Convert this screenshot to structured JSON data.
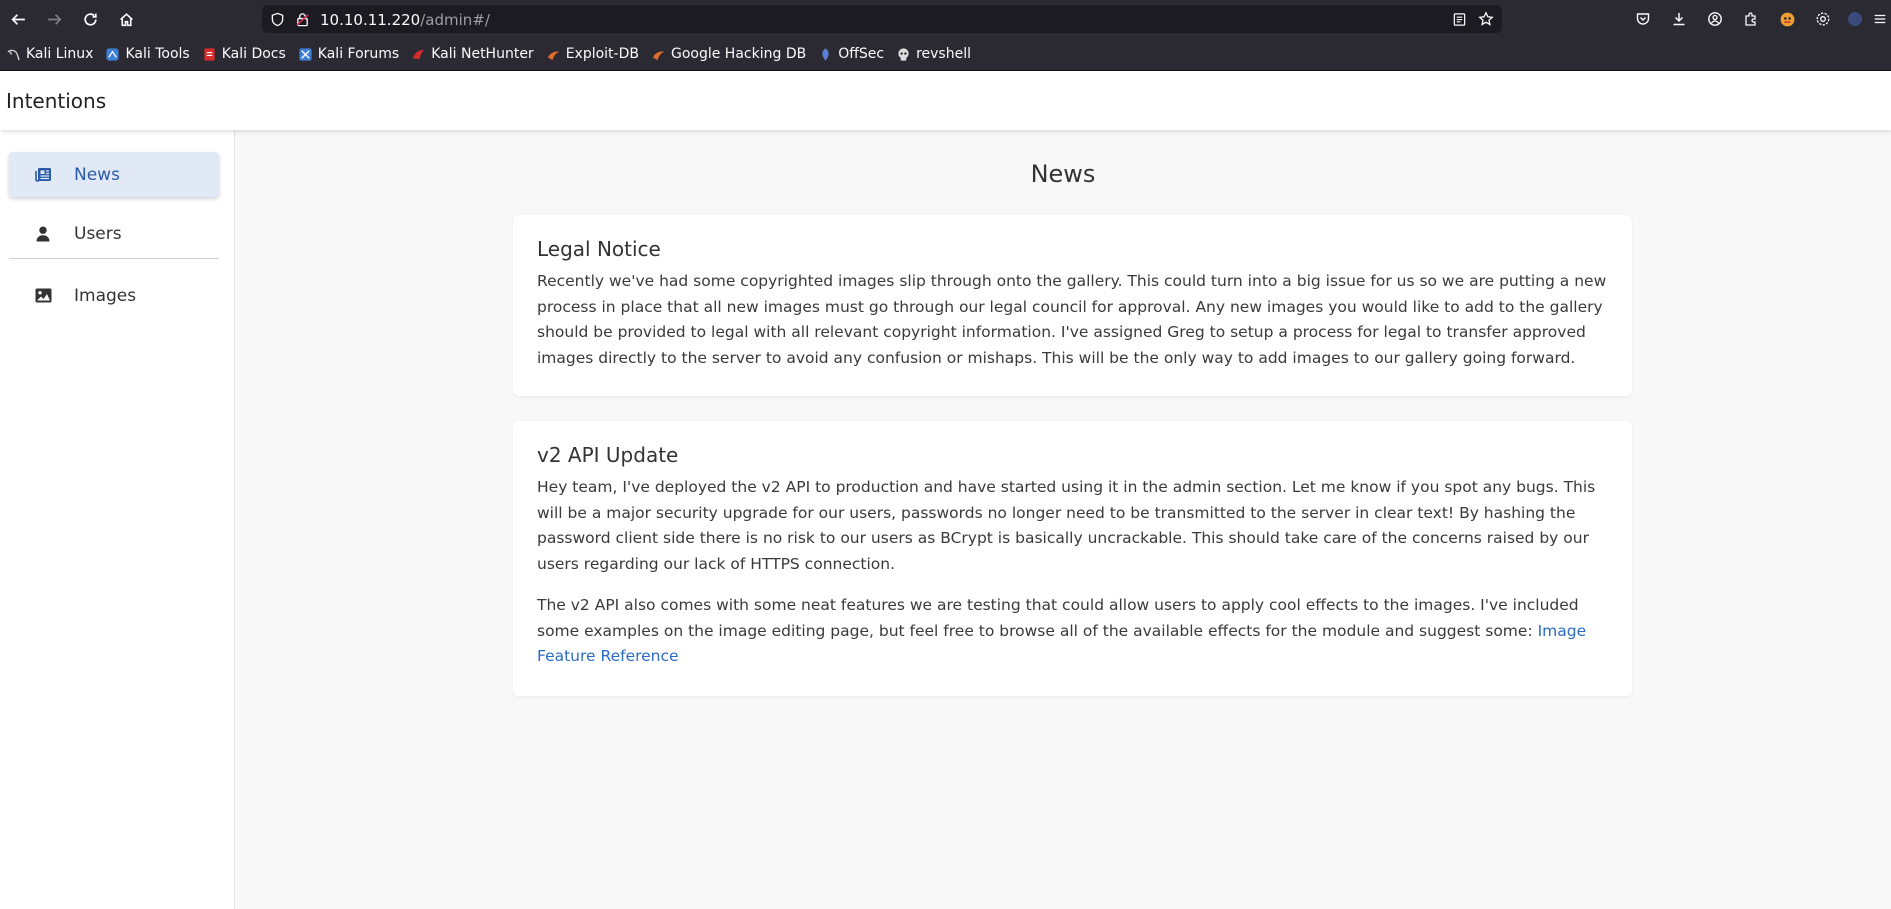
{
  "browser": {
    "url_host": "10.10.11.220",
    "url_path": "/admin#/",
    "bookmarks": [
      {
        "label": "Kali Linux",
        "icon": "kali-dragon-icon",
        "color": "#cccccc"
      },
      {
        "label": "Kali Tools",
        "icon": "kali-tools-icon",
        "color": "#3d7fd6"
      },
      {
        "label": "Kali Docs",
        "icon": "kali-docs-icon",
        "color": "#d62b2b"
      },
      {
        "label": "Kali Forums",
        "icon": "kali-forums-icon",
        "color": "#3d7fd6"
      },
      {
        "label": "Kali NetHunter",
        "icon": "kali-nethunter-icon",
        "color": "#d62b2b"
      },
      {
        "label": "Exploit-DB",
        "icon": "exploit-db-icon",
        "color": "#e06a2a"
      },
      {
        "label": "Google Hacking DB",
        "icon": "ghdb-icon",
        "color": "#e06a2a"
      },
      {
        "label": "OffSec",
        "icon": "offsec-icon",
        "color": "#5b7fd6"
      },
      {
        "label": "revshell",
        "icon": "skull-icon",
        "color": "#dddddd"
      }
    ]
  },
  "app": {
    "title": "Intentions"
  },
  "sidebar": {
    "items": [
      {
        "label": "News",
        "icon": "newspaper-icon",
        "active": true
      },
      {
        "label": "Users",
        "icon": "user-icon",
        "active": false
      },
      {
        "label": "Images",
        "icon": "image-icon",
        "active": false
      }
    ]
  },
  "main": {
    "title": "News",
    "posts": [
      {
        "title": "Legal Notice",
        "paragraphs": [
          "Recently we've had some copyrighted images slip through onto the gallery. This could turn into a big issue for us so we are putting a new process in place that all new images must go through our legal council for approval. Any new images you would like to add to the gallery should be provided to legal with all relevant copyright information. I've assigned Greg to setup a process for legal to transfer approved images directly to the server to avoid any confusion or mishaps. This will be the only way to add images to our gallery going forward."
        ]
      },
      {
        "title": "v2 API Update",
        "paragraphs": [
          "Hey team, I've deployed the v2 API to production and have started using it in the admin section. Let me know if you spot any bugs. This will be a major security upgrade for our users, passwords no longer need to be transmitted to the server in clear text! By hashing the password client side there is no risk to our users as BCrypt is basically uncrackable. This should take care of the concerns raised by our users regarding our lack of HTTPS connection.",
          "The v2 API also comes with some neat features we are testing that could allow users to apply cool effects to the images. I've included some examples on the image editing page, but feel free to browse all of the available effects for the module and suggest some: "
        ],
        "link_label": "Image Feature Reference"
      }
    ]
  }
}
